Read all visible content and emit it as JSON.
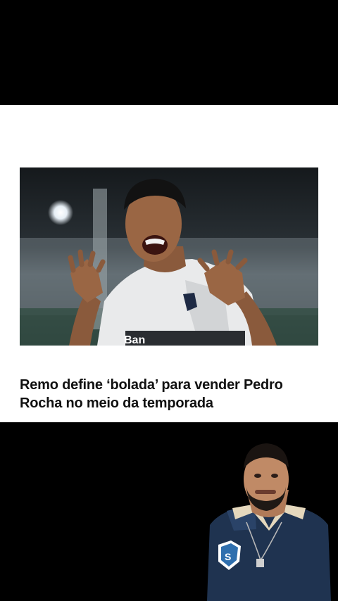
{
  "article": {
    "headline": "Remo define ‘bolada’ para vender Pedro Rocha no meio da temporada",
    "photo_icon": "soccer-player-celebrating-photo",
    "shirt_sponsor": "Ban"
  },
  "presenter": {
    "icon": "presenter-webcam-overlay"
  },
  "colors": {
    "background": "#000000",
    "card": "#ffffff",
    "headline_text": "#111111",
    "presenter_shirt": "#1f3350"
  }
}
